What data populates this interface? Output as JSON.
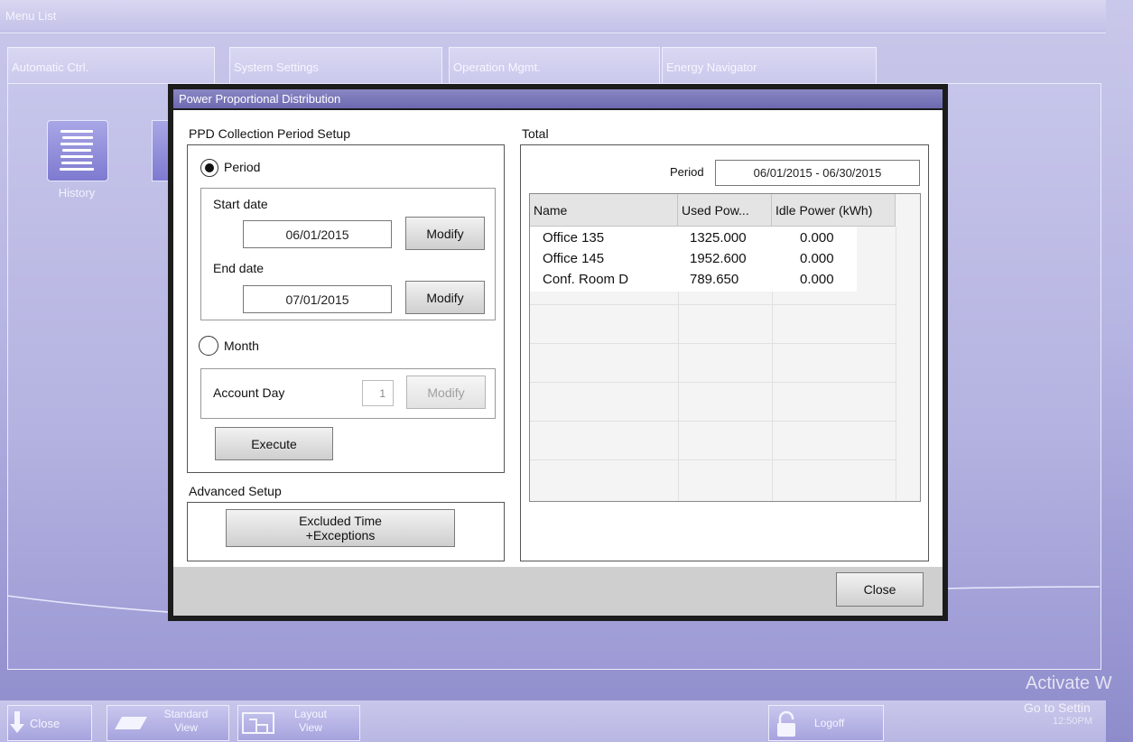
{
  "menu_bar": {
    "title": "Menu List"
  },
  "tabs": [
    {
      "label": "Automatic Ctrl."
    },
    {
      "label": "System Settings"
    },
    {
      "label": "Operation Mgmt."
    },
    {
      "label": "Energy Navigator"
    }
  ],
  "desktop": {
    "history_label": "History"
  },
  "dialog": {
    "title": "Power Proportional Distribution",
    "collection": {
      "heading": "PPD Collection Period Setup",
      "period_label": "Period",
      "start_label": "Start date",
      "start_value": "06/01/2015",
      "end_label": "End date",
      "end_value": "07/01/2015",
      "modify_label": "Modify",
      "month_label": "Month",
      "account_day_label": "Account Day",
      "account_day_value": "1",
      "execute_label": "Execute"
    },
    "advanced": {
      "heading": "Advanced Setup",
      "excluded_line1": "Excluded Time",
      "excluded_line2": "+Exceptions"
    },
    "total": {
      "heading": "Total",
      "period_label": "Period",
      "period_value": "06/01/2015 - 06/30/2015",
      "columns": [
        "Name",
        "Used Pow...",
        "Idle Power (kWh)"
      ],
      "rows": [
        {
          "name": "Office 135",
          "used": "1325.000",
          "idle": "0.000"
        },
        {
          "name": "Office 145",
          "used": "1952.600",
          "idle": "0.000"
        },
        {
          "name": "Conf. Room D",
          "used": "789.650",
          "idle": "0.000"
        }
      ]
    },
    "close_label": "Close"
  },
  "toolbar": {
    "close_label": "Close",
    "standard_line1": "Standard",
    "standard_line2": "View",
    "layout_line1": "Layout",
    "layout_line2": "View",
    "logoff_label": "Logoff"
  },
  "watermark": {
    "line1": "Activate W",
    "line2": "Go to Settin",
    "time": "12:50PM"
  }
}
